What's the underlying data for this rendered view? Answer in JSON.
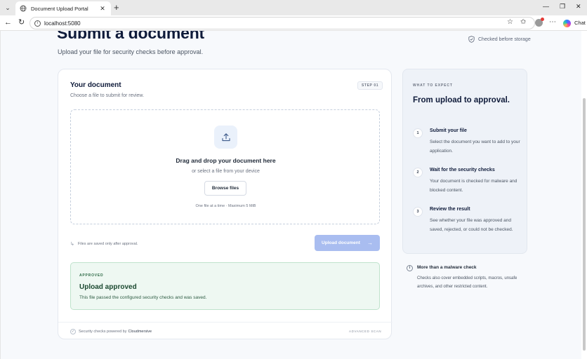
{
  "browser": {
    "tab_title": "Document Upload Portal",
    "url": "localhost:5080",
    "chat_label": "Chat",
    "icons": [
      "tab-menu-icon",
      "globe-icon",
      "close-icon",
      "plus-icon",
      "minimize-icon",
      "restore-icon",
      "close-window-icon",
      "back-icon",
      "reload-icon",
      "info-icon",
      "star-icon",
      "favorites-icon",
      "profile-icon",
      "more-icon",
      "copilot-icon"
    ]
  },
  "header": {
    "title": "Submit a document",
    "subtitle": "Upload your file for security checks before approval.",
    "checked_label": "Checked before storage"
  },
  "card": {
    "title": "Your document",
    "subtitle": "Choose a file to submit for review.",
    "step_badge": "STEP 01",
    "dropzone": {
      "title": "Drag and drop your document here",
      "subtitle": "or select a file from your device",
      "browse_label": "Browse files",
      "note": "One file at a time · Maximum 5 MiB"
    },
    "saved_note": "Files are saved only after approval.",
    "upload_label": "Upload document",
    "upload_arrow": "→",
    "result": {
      "eyebrow": "APPROVED",
      "title": "Upload approved",
      "text": "This file passed the configured security checks and was saved."
    },
    "footer": {
      "powered_prefix": "Security checks powered by",
      "powered_brand": "Cloudmersive",
      "advanced": "ADVANCED SCAN"
    }
  },
  "side": {
    "eyebrow": "WHAT TO EXPECT",
    "title": "From upload to approval.",
    "steps": [
      {
        "num": "1",
        "title": "Submit your file",
        "desc": "Select the document you want to add to your application."
      },
      {
        "num": "2",
        "title": "Wait for the security checks",
        "desc": "Your document is checked for malware and blocked content."
      },
      {
        "num": "3",
        "title": "Review the result",
        "desc": "See whether your file was approved and saved, rejected, or could not be checked."
      }
    ]
  },
  "info": {
    "title": "More than a malware check",
    "text": "Checks also cover embedded scripts, macros, unsafe archives, and other restricted content."
  },
  "colors": {
    "accent": "#a9bdf0",
    "success_bg": "#eef8f2",
    "success_text": "#1c4a31",
    "title": "#0f1b3a"
  }
}
